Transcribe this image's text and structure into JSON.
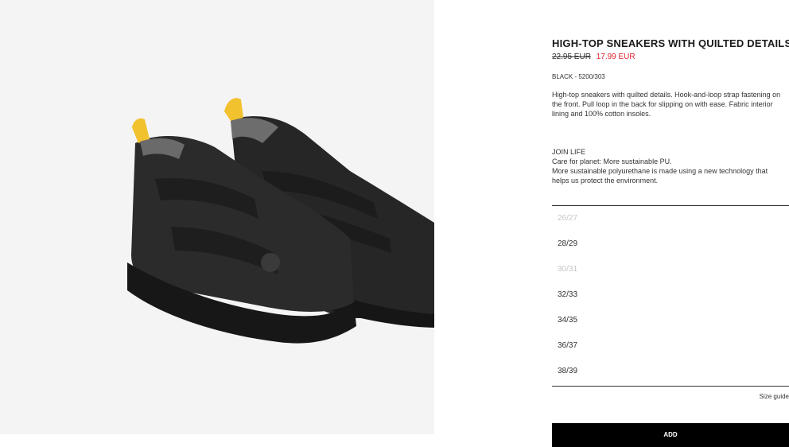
{
  "product": {
    "image_alt": "Black high-top sneakers with quilted details and yellow pull loops",
    "title": "HIGH-TOP SNEAKERS WITH QUILTED DETAILS",
    "old_price": "22.95 EUR",
    "new_price": "17.99 EUR",
    "color_ref": "BLACK - 5200/303",
    "description": "High-top sneakers with quilted details. Hook-and-loop strap fastening on the front. Pull loop in the back for slipping on with ease. Fabric interior lining and 100% cotton insoles.",
    "join_life": {
      "heading": "JOIN LIFE",
      "line1": "Care for planet: More sustainable PU.",
      "line2": "More sustainable polyurethane is made using a new technology that helps us protect the environment."
    },
    "sizes": [
      {
        "label": "26/27",
        "available": false
      },
      {
        "label": "28/29",
        "available": true
      },
      {
        "label": "30/31",
        "available": false
      },
      {
        "label": "32/33",
        "available": true
      },
      {
        "label": "34/35",
        "available": true
      },
      {
        "label": "36/37",
        "available": true
      },
      {
        "label": "38/39",
        "available": true
      }
    ],
    "size_guide": "Size guide",
    "add_button": "ADD"
  },
  "colors": {
    "sale_red": "#e0242e",
    "image_bg": "#f4f4f4",
    "shoe": "#222222",
    "pull_loop": "#f2c12e"
  }
}
